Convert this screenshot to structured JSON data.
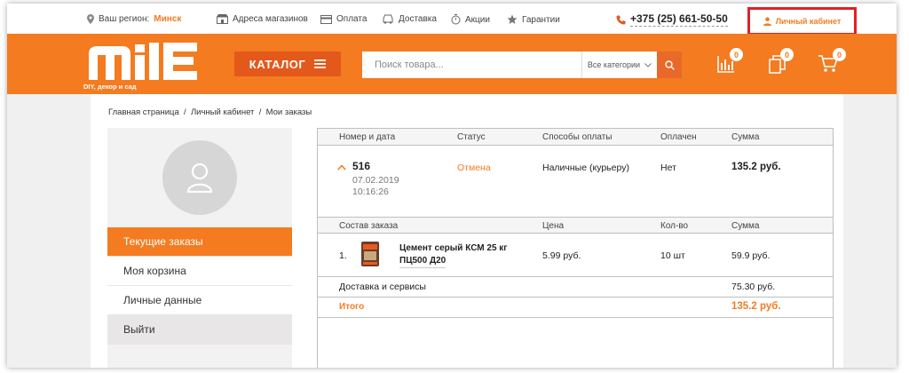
{
  "topbar": {
    "region_label": "Ваш регион:",
    "region_city": "Минск",
    "links": [
      "Адреса магазинов",
      "Оплата",
      "Доставка",
      "Акции",
      "Гарантии"
    ],
    "phone": "+375 (25) 661-50-50",
    "account": "Личный кабинет"
  },
  "header": {
    "logo_subtitle": "DIY, декор и сад",
    "catalog_label": "КАТАЛОГ",
    "search_placeholder": "Поиск товара...",
    "category_select": "Все категории",
    "compare_count": "0",
    "favorites_count": "0",
    "cart_count": "0"
  },
  "breadcrumb": "Главная страница  /  Личный кабинет  /  Мои заказы",
  "sidebar": {
    "items": [
      "Текущие заказы",
      "Моя корзина",
      "Личные данные",
      "Выйти"
    ]
  },
  "orders_table": {
    "headers": [
      "Номер и дата",
      "Статус",
      "Способы оплаты",
      "Оплачен",
      "Сумма"
    ],
    "order": {
      "number": "516",
      "date": "07.02.2019",
      "time": "10:16:26",
      "status": "Отмена",
      "payment": "Наличные (курьеру)",
      "paid": "Нет",
      "sum": "135.2 руб."
    },
    "items_headers": [
      "Состав заказа",
      "Цена",
      "Кол-во",
      "Сумма"
    ],
    "items": [
      {
        "index": "1.",
        "name_line1": "Цемент серый КСМ 25 кг",
        "name_line2": "ПЦ500 Д20",
        "price": "5.99 руб.",
        "qty": "10 шт",
        "sum": "59.9 руб."
      }
    ],
    "delivery_label": "Доставка и сервисы",
    "delivery_sum": "75.30 руб.",
    "total_label": "Итого",
    "total_sum": "135.2 руб."
  },
  "colors": {
    "accent": "#f47b20",
    "accent_dark": "#e2591b",
    "highlight_box": "#e32020"
  }
}
